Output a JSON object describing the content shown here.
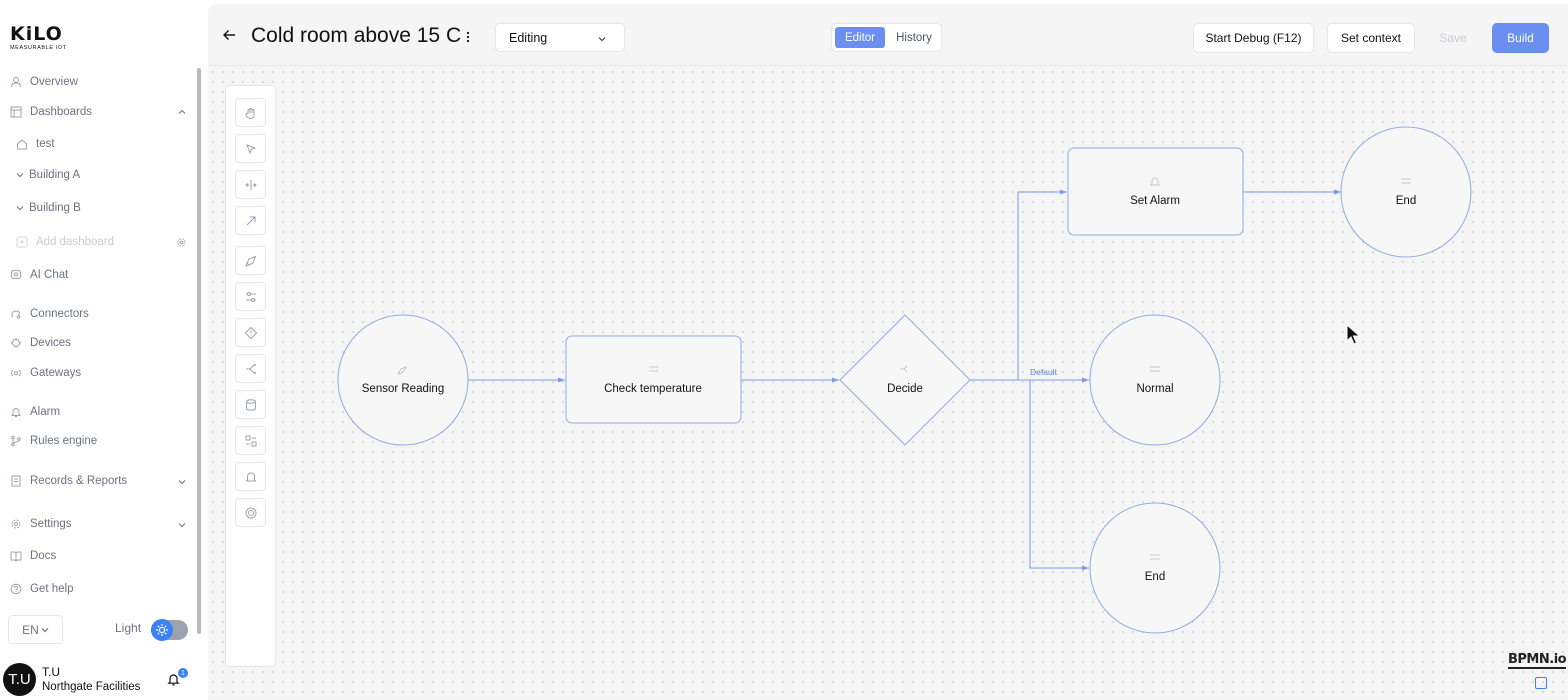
{
  "sidebar": {
    "logo_text": "KiLO",
    "logo_subtext": "MEASURABLE IOT",
    "items": [
      {
        "label": "Overview",
        "icon": "user-icon"
      },
      {
        "label": "Dashboards",
        "icon": "dashboard-icon",
        "expanded": true
      },
      {
        "label": "test",
        "icon": "home-icon"
      },
      {
        "label": "Building A",
        "icon": "chevron-down-icon"
      },
      {
        "label": "Building B",
        "icon": "chevron-down-icon"
      },
      {
        "label": "Add dashboard",
        "icon": "plus-square-icon",
        "disabled": true
      },
      {
        "label": "AI Chat",
        "icon": "ai-chat-icon"
      },
      {
        "label": "Connectors",
        "icon": "connectors-icon"
      },
      {
        "label": "Devices",
        "icon": "cpu-icon"
      },
      {
        "label": "Gateways",
        "icon": "gateway-icon"
      },
      {
        "label": "Alarm",
        "icon": "bell-icon"
      },
      {
        "label": "Rules engine",
        "icon": "branch-icon"
      },
      {
        "label": "Records & Reports",
        "icon": "report-icon"
      },
      {
        "label": "Settings",
        "icon": "gear-icon"
      },
      {
        "label": "Docs",
        "icon": "book-icon"
      },
      {
        "label": "Get help",
        "icon": "help-icon"
      }
    ],
    "language": "EN",
    "theme_label": "Light",
    "user": {
      "initials": "T.U",
      "name": "T.U",
      "org": "Northgate Facilities",
      "notifications": "1"
    }
  },
  "header": {
    "title": "Cold room above 15 C",
    "mode": "Editing",
    "tabs": {
      "editor": "Editor",
      "history": "History",
      "active": "editor"
    },
    "buttons": {
      "debug": "Start Debug (F12)",
      "context": "Set context",
      "save": "Save",
      "build": "Build"
    }
  },
  "diagram": {
    "nodes": {
      "sensor": "Sensor Reading",
      "check": "Check temperature",
      "decide": "Decide",
      "alarm": "Set Alarm",
      "end1": "End",
      "normal": "Normal",
      "end2": "End"
    },
    "edge_label_default": "Default"
  },
  "footer": {
    "bpmn_logo": "BPMN.io"
  },
  "colors": {
    "accent": "#6b8ff0",
    "flow": "#7c9be8",
    "node_border": "#8fa9e8"
  }
}
